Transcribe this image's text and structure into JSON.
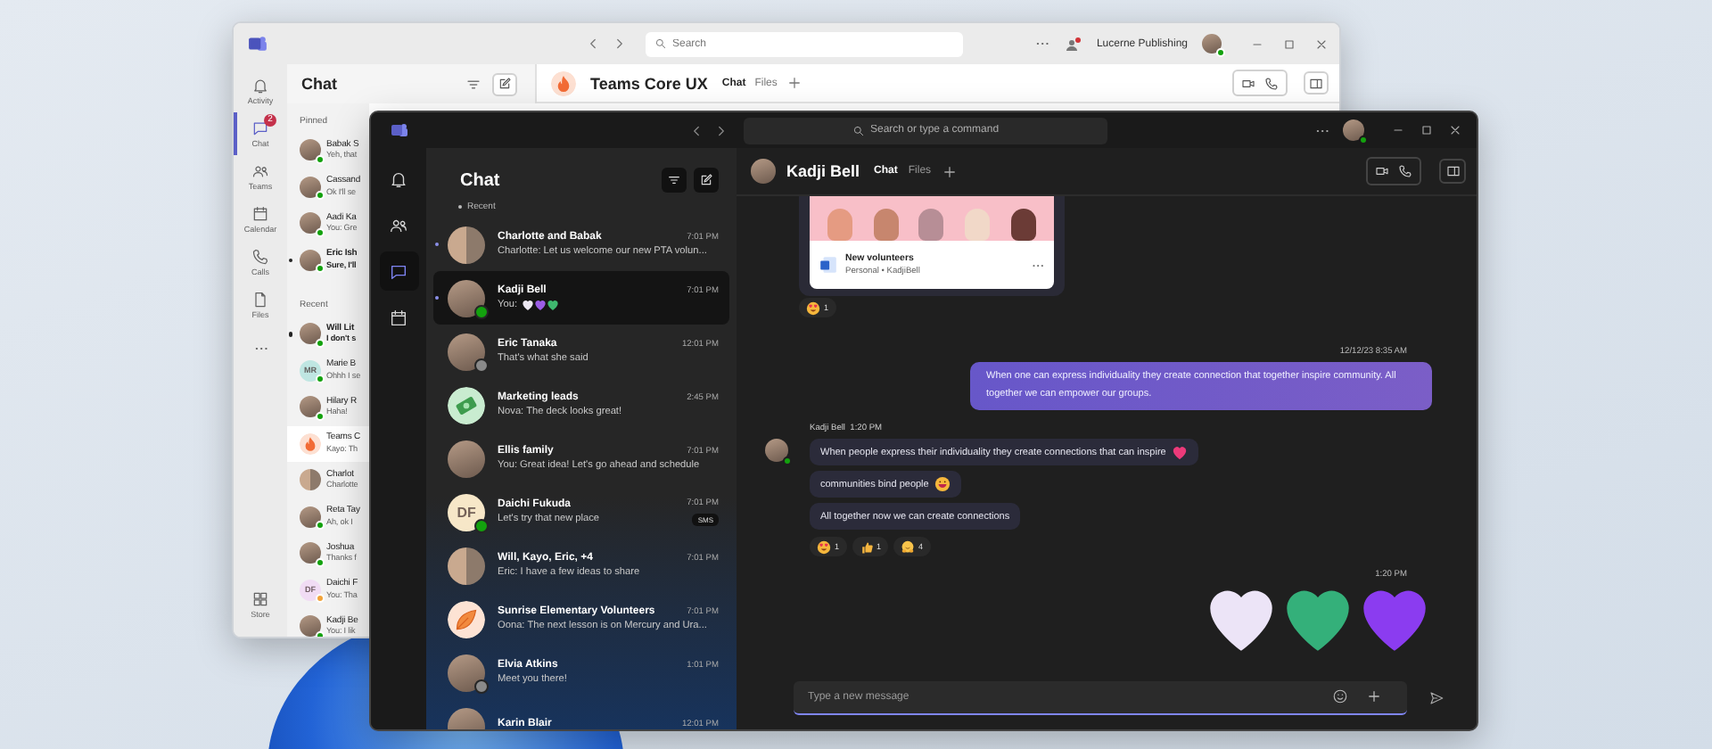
{
  "back_window": {
    "search": {
      "placeholder": "Search"
    },
    "account": {
      "name": "Lucerne Publishing",
      "presence": {
        "color": "#13a10e"
      }
    },
    "rail": [
      {
        "kind": "bell",
        "label": "Activity",
        "selected": false
      },
      {
        "kind": "chat",
        "label": "Chat",
        "selected": true,
        "badge": "2"
      },
      {
        "kind": "people",
        "label": "Teams",
        "selected": false
      },
      {
        "kind": "calendar",
        "label": "Calendar",
        "selected": false
      },
      {
        "kind": "phone",
        "label": "Calls",
        "selected": false
      },
      {
        "kind": "file",
        "label": "Files",
        "selected": false
      },
      {
        "kind": "more",
        "selected": false
      }
    ],
    "rail_bottom": [
      {
        "kind": "store",
        "label": "Store",
        "selected": false
      }
    ],
    "list": {
      "title": "Chat",
      "sections": [
        {
          "title": "Pinned",
          "items": [
            {
              "name": "Babak S",
              "preview": "Yeh, that",
              "avatar": {
                "kind": "photo"
              },
              "presence": {
                "color": "#13a10e"
              },
              "unread": false,
              "selected": false
            },
            {
              "name": "Cassand",
              "preview": "Ok I'll se",
              "avatar": {
                "kind": "photo"
              },
              "presence": {
                "color": "#13a10e"
              },
              "unread": false,
              "selected": false
            },
            {
              "name": "Aadi Ka",
              "preview": "You: Gre",
              "avatar": {
                "kind": "photo"
              },
              "presence": {
                "color": "#13a10e"
              },
              "unread": false,
              "selected": false
            },
            {
              "name": "Eric Ish",
              "preview": "Sure, I'll",
              "avatar": {
                "kind": "photo"
              },
              "presence": {
                "color": "#13a10e"
              },
              "unread": true,
              "selected": false
            }
          ]
        },
        {
          "title": "Recent",
          "items": [
            {
              "name": "Will Lit",
              "preview": "I don't s",
              "avatar": {
                "kind": "photo"
              },
              "presence": {
                "color": "#13a10e"
              },
              "unread": true,
              "selected": false
            },
            {
              "name": "Marie B",
              "preview": "Ohhh I se",
              "avatar": {
                "kind": "initials",
                "initials": "MR",
                "color": "#bfe6e2"
              },
              "presence": {
                "color": "#13a10e"
              },
              "unread": false,
              "selected": false
            },
            {
              "name": "Hilary R",
              "preview": "Haha!",
              "avatar": {
                "kind": "photo"
              },
              "presence": {
                "color": "#13a10e"
              },
              "unread": false,
              "selected": false
            },
            {
              "name": "Teams C",
              "preview": "Kayo: Th",
              "avatar": {
                "kind": "flame"
              },
              "unread": false,
              "selected": true
            },
            {
              "name": "Charlot",
              "preview": "Charlotte",
              "avatar": {
                "kind": "group"
              },
              "unread": false,
              "selected": false
            },
            {
              "name": "Reta Tay",
              "preview": "Ah, ok I",
              "avatar": {
                "kind": "photo"
              },
              "presence": {
                "color": "#13a10e"
              },
              "unread": false,
              "selected": false
            },
            {
              "name": "Joshua",
              "preview": "Thanks f",
              "avatar": {
                "kind": "photo"
              },
              "presence": {
                "color": "#13a10e"
              },
              "unread": false,
              "selected": false
            },
            {
              "name": "Daichi F",
              "preview": "You: Tha",
              "avatar": {
                "kind": "initials",
                "initials": "DF",
                "color": "#f1dcf4"
              },
              "presence": {
                "color": "#f2a33a"
              },
              "unread": false,
              "selected": false
            },
            {
              "name": "Kadji Be",
              "preview": "You: I lik",
              "avatar": {
                "kind": "photo"
              },
              "presence": {
                "color": "#13a10e"
              },
              "unread": false,
              "selected": false
            }
          ]
        }
      ]
    },
    "chat": {
      "title": "Teams Core UX",
      "avatar": {
        "kind": "flame"
      },
      "tabs": [
        {
          "label": "Chat",
          "selected": true
        },
        {
          "label": "Files",
          "selected": false
        }
      ]
    }
  },
  "front_window": {
    "search": {
      "placeholder": "Search or type a command"
    },
    "account": {
      "presence": {
        "color": "#13a10e"
      }
    },
    "rail": [
      {
        "kind": "bell",
        "selected": false
      },
      {
        "kind": "people",
        "selected": false
      },
      {
        "kind": "chat",
        "selected": true
      },
      {
        "kind": "calendar",
        "selected": false
      }
    ],
    "list": {
      "title": "Chat",
      "section": "Recent",
      "items": [
        {
          "name": "Charlotte and Babak",
          "preview": "Charlotte: Let us welcome our new PTA volun...",
          "time": "7:01 PM",
          "avatar": {
            "kind": "group"
          },
          "unread": true,
          "selected": false
        },
        {
          "name": "Kadji Bell",
          "preview": "You:",
          "preview_hearts": [
            {
              "color": "#ece8f2"
            },
            {
              "color": "#9b5de5"
            },
            {
              "color": "#3fb86f"
            }
          ],
          "time": "7:01 PM",
          "avatar": {
            "kind": "photo"
          },
          "presence": {
            "color": "#13a10e"
          },
          "unread": true,
          "selected": true
        },
        {
          "name": "Eric Tanaka",
          "preview": "That's what she said",
          "time": "12:01 PM",
          "avatar": {
            "kind": "photo"
          },
          "presence": {
            "color": "#8a8a8a"
          },
          "unread": false,
          "selected": false
        },
        {
          "name": "Marketing leads",
          "preview": "Nova: The deck looks great!",
          "time": "2:45 PM",
          "avatar": {
            "kind": "money"
          },
          "unread": false,
          "selected": false
        },
        {
          "name": "Ellis family",
          "preview": "You: Great idea! Let's go ahead and schedule",
          "time": "7:01 PM",
          "avatar": {
            "kind": "photo"
          },
          "unread": false,
          "selected": false
        },
        {
          "name": "Daichi Fukuda",
          "preview": "Let's try that new place",
          "time": "7:01 PM",
          "badge": "SMS",
          "avatar": {
            "kind": "initials",
            "initials": "DF",
            "color": "#f7e7c8"
          },
          "presence": {
            "color": "#13a10e"
          },
          "unread": false,
          "selected": false
        },
        {
          "name": "Will, Kayo, Eric, +4",
          "preview": "Eric: I have a few ideas to share",
          "time": "7:01 PM",
          "avatar": {
            "kind": "group"
          },
          "unread": false,
          "selected": false
        },
        {
          "name": "Sunrise Elementary Volunteers",
          "preview": "Oona: The next lesson is on Mercury and Ura...",
          "time": "7:01 PM",
          "avatar": {
            "kind": "leaf"
          },
          "unread": false,
          "selected": false
        },
        {
          "name": "Elvia Atkins",
          "preview": "Meet you there!",
          "time": "1:01 PM",
          "avatar": {
            "kind": "photo"
          },
          "presence": {
            "color": "#8a8a8a"
          },
          "unread": false,
          "selected": false
        },
        {
          "name": "Karin Blair",
          "time": "12:01 PM",
          "avatar": {
            "kind": "photo"
          },
          "unread": false,
          "selected": false
        }
      ]
    },
    "chat": {
      "title": "Kadji Bell",
      "tabs": [
        {
          "label": "Chat",
          "selected": true
        },
        {
          "label": "Files",
          "selected": false
        }
      ],
      "messages": [
        {
          "kind": "card",
          "title": "New volunteers",
          "subtitle": "Personal • KadjiBell",
          "reactions": [
            {
              "kind": "smile",
              "count": "1"
            }
          ]
        },
        {
          "kind": "outgoing",
          "time": "12/12/23 8:35 AM",
          "text": "When one can express individuality they create connection that together inspire community. All together we can empower our groups."
        },
        {
          "kind": "incoming",
          "sender": "Kadji Bell",
          "time": "1:20 PM",
          "presence": {
            "color": "#13a10e"
          },
          "bubbles": [
            {
              "kind": "with_heart",
              "text": "When people express their individuality they create connections that can inspire"
            },
            {
              "kind": "with_grin",
              "text": "communities bind people"
            },
            {
              "kind": "plain",
              "text": "All together now we can create connections"
            }
          ],
          "reactions": [
            {
              "kind": "smile",
              "count": "1"
            },
            {
              "kind": "thumbs",
              "count": "1"
            },
            {
              "kind": "hug",
              "count": "4"
            }
          ]
        },
        {
          "kind": "hearts",
          "time": "1:20 PM",
          "hearts": [
            {
              "color": "#ece4f7"
            },
            {
              "color": "#34b07a"
            },
            {
              "color": "#8b3cf0"
            }
          ]
        }
      ],
      "composer": {
        "placeholder": "Type a new message"
      }
    }
  }
}
